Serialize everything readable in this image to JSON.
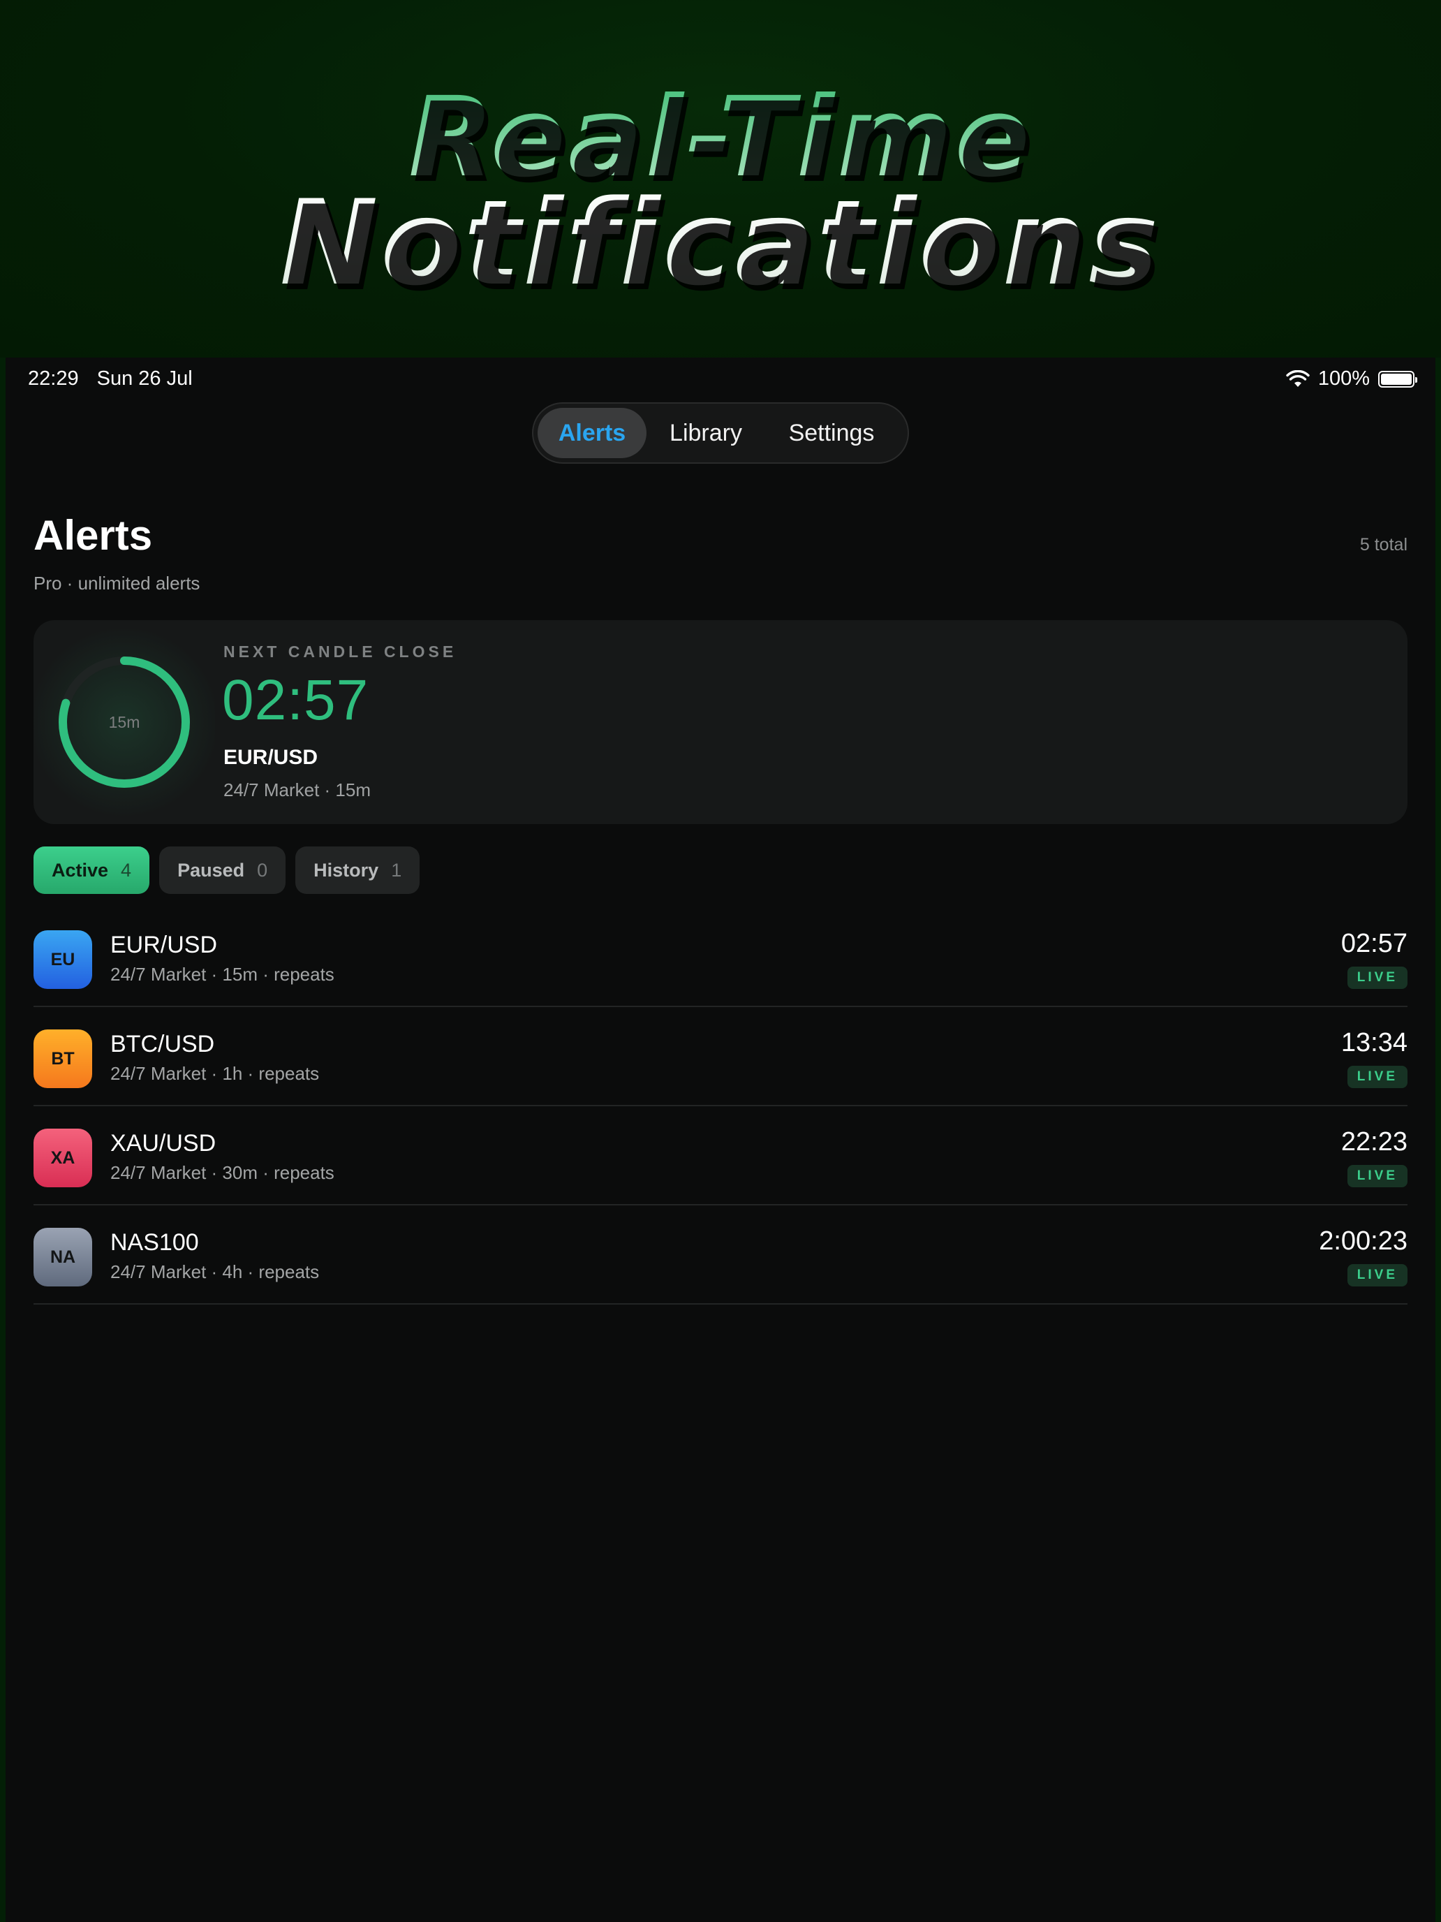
{
  "hero": {
    "line1": "Real-Time",
    "line2": "Notifications"
  },
  "status_bar": {
    "time": "22:29",
    "date": "Sun 26 Jul",
    "battery": "100%",
    "wifi_icon": "wifi-icon",
    "battery_icon": "battery-icon",
    "battery_level": 1.0
  },
  "nav": {
    "tabs": [
      {
        "label": "Alerts",
        "selected": true
      },
      {
        "label": "Library",
        "selected": false
      },
      {
        "label": "Settings",
        "selected": false
      }
    ]
  },
  "page": {
    "title": "Alerts",
    "subtitle": "Pro · unlimited alerts",
    "total": "5 total"
  },
  "candle_card": {
    "kicker": "NEXT CANDLE CLOSE",
    "countdown": "02:57",
    "pair": "EUR/USD",
    "meta": "24/7 Market · 15m",
    "ring_label": "15m",
    "ring_progress": 0.8,
    "accent": "#2fbe7e"
  },
  "filters": [
    {
      "label": "Active",
      "count": "4",
      "selected": true
    },
    {
      "label": "Paused",
      "count": "0",
      "selected": false
    },
    {
      "label": "History",
      "count": "1",
      "selected": false
    }
  ],
  "alerts": [
    {
      "badge": "EU",
      "pair": "EUR/USD",
      "meta": "24/7 Market · 15m · repeats",
      "timer": "02:57",
      "status": "LIVE",
      "color_top": "#3aa6f2",
      "color_bottom": "#2360e0"
    },
    {
      "badge": "BT",
      "pair": "BTC/USD",
      "meta": "24/7 Market · 1h · repeats",
      "timer": "13:34",
      "status": "LIVE",
      "color_top": "#ffb02a",
      "color_bottom": "#f5781d"
    },
    {
      "badge": "XA",
      "pair": "XAU/USD",
      "meta": "24/7 Market · 30m · repeats",
      "timer": "22:23",
      "status": "LIVE",
      "color_top": "#f4627c",
      "color_bottom": "#d92e54"
    },
    {
      "badge": "NA",
      "pair": "NAS100",
      "meta": "24/7 Market · 4h · repeats",
      "timer": "2:00:23",
      "status": "LIVE",
      "color_top": "#9aa3b3",
      "color_bottom": "#5f6a7d"
    }
  ]
}
